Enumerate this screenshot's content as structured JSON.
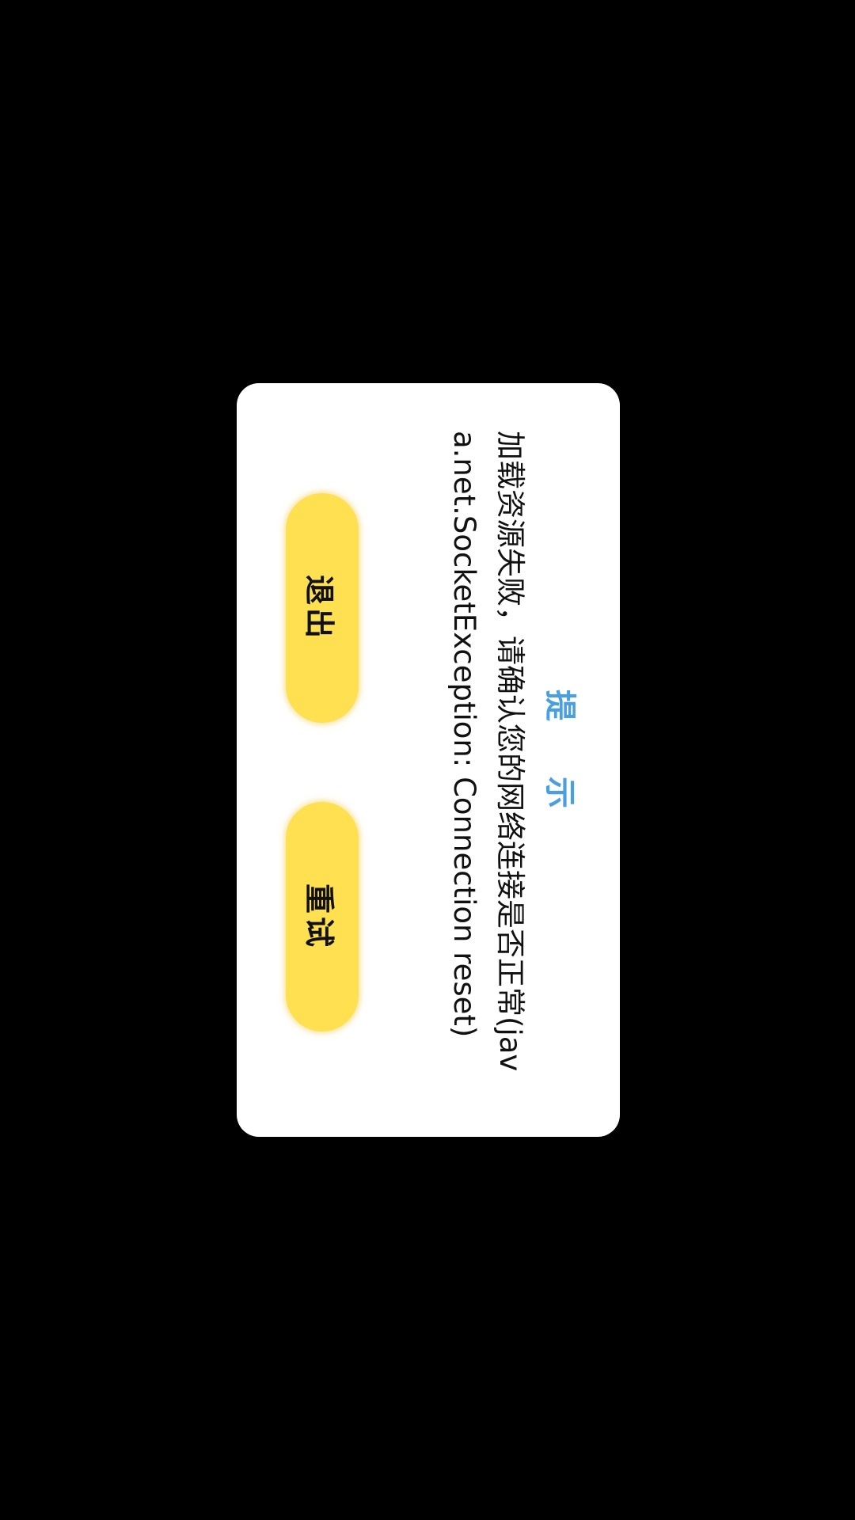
{
  "dialog": {
    "title": "提 示",
    "message": "加载资源失败，请确认您的网络连接是否正常(java.net.SocketException: Connection reset)",
    "buttons": {
      "exit_label": "退出",
      "retry_label": "重试"
    }
  },
  "colors": {
    "background": "#000000",
    "dialog": "#ffffff",
    "title": "#4a9fe0",
    "button": "#ffe050"
  }
}
